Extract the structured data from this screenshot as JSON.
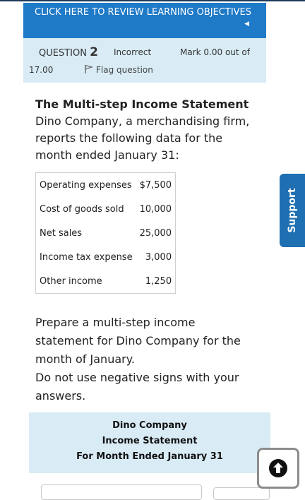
{
  "banner": {
    "text": "CLICK HERE TO REVIEW LEARNING OBJECTIVES",
    "chevron": "◀"
  },
  "question": {
    "label": "QUESTION",
    "number": "2",
    "status": "Incorrect",
    "mark_line1": "Mark 0.00 out of",
    "mark_line2": "17.00",
    "flag_label": "Flag question"
  },
  "problem": {
    "title": "The Multi-step Income Statement",
    "description": "Dino Company, a merchandising firm, reports the following data for the month ended January 31:"
  },
  "data_table": [
    {
      "label": "Operating expenses",
      "value": "$7,500"
    },
    {
      "label": "Cost of goods sold",
      "value": "10,000"
    },
    {
      "label": "Net sales",
      "value": "25,000"
    },
    {
      "label": "Income tax expense",
      "value": "3,000"
    },
    {
      "label": "Other income",
      "value": "1,250"
    }
  ],
  "instructions": {
    "line1": "Prepare a multi-step income statement for Dino Company for the month of January.",
    "line2": "Do not use negative signs with your answers."
  },
  "statement_header": {
    "company": "Dino Company",
    "name": "Income Statement",
    "period": "For Month Ended January 31"
  },
  "support_tab": {
    "label": "Support"
  },
  "icons": {
    "flag": "flag-icon",
    "scroll_top": "arrow-up-icon"
  },
  "colors": {
    "banner": "#1f7ac7",
    "info_bg": "#d9ecf6",
    "support": "#1f6fb3"
  }
}
